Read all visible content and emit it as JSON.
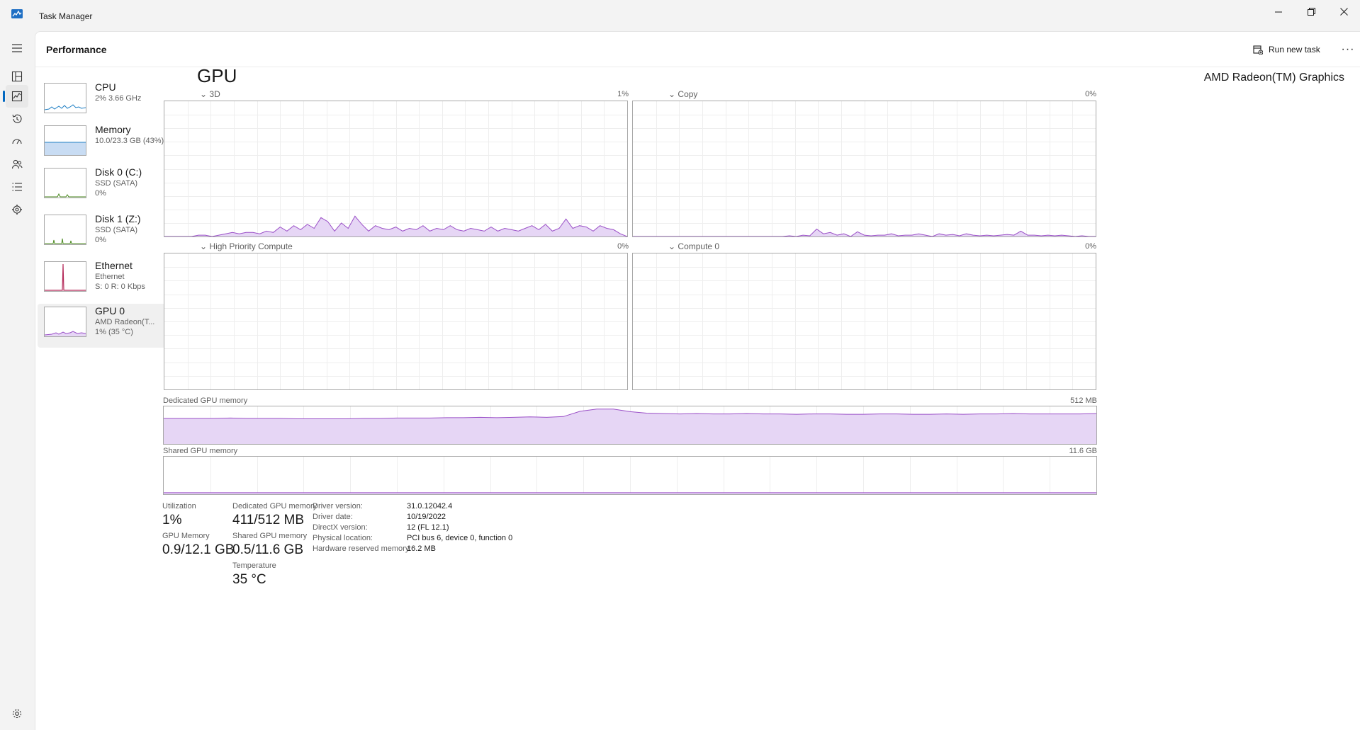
{
  "window": {
    "title": "Task Manager",
    "controls": {
      "minimize": "—",
      "maximize": "❐",
      "close": "✕"
    }
  },
  "rail": {
    "items": [
      {
        "name": "hamburger-menu-icon",
        "glyph": "☰"
      },
      {
        "name": "processes-icon",
        "glyph": "▦"
      },
      {
        "name": "performance-icon",
        "glyph": "📈",
        "active": true
      },
      {
        "name": "app-history-icon",
        "glyph": "↺"
      },
      {
        "name": "startup-apps-icon",
        "glyph": "⚡"
      },
      {
        "name": "users-icon",
        "glyph": "👥"
      },
      {
        "name": "details-icon",
        "glyph": "≣"
      },
      {
        "name": "services-icon",
        "glyph": "⚙"
      }
    ],
    "settings_glyph": "⚙"
  },
  "header": {
    "title": "Performance",
    "run_new_task": "Run new task",
    "more": "···"
  },
  "devices": [
    {
      "name": "CPU",
      "line1": "2% 3.66 GHz",
      "line2": "",
      "color": "#1f7fc4"
    },
    {
      "name": "Memory",
      "line1": "10.0/23.3 GB (43%)",
      "line2": "",
      "color": "#7d6bd3"
    },
    {
      "name": "Disk 0 (C:)",
      "line1": "SSD (SATA)",
      "line2": "0%",
      "color": "#4b8a1f"
    },
    {
      "name": "Disk 1 (Z:)",
      "line1": "SSD (SATA)",
      "line2": "0%",
      "color": "#4b8a1f"
    },
    {
      "name": "Ethernet",
      "line1": "Ethernet",
      "line2": "S: 0 R: 0 Kbps",
      "color": "#b52c5b"
    },
    {
      "name": "GPU 0",
      "line1": "AMD Radeon(T...",
      "line2": "1% (35 °C)",
      "color": "#9a4fc7",
      "selected": true
    }
  ],
  "gpu": {
    "title": "GPU",
    "model": "AMD Radeon(TM) Graphics",
    "accent": "#9a4fc7",
    "fill": "#e6d6f5",
    "engines": [
      {
        "label": "3D",
        "value": "1%"
      },
      {
        "label": "Copy",
        "value": "0%"
      },
      {
        "label": "High Priority Compute",
        "value": "0%"
      },
      {
        "label": "Compute 0",
        "value": "0%"
      }
    ],
    "dedicated": {
      "label": "Dedicated GPU memory",
      "max": "512 MB"
    },
    "shared": {
      "label": "Shared GPU memory",
      "max": "11.6 GB"
    }
  },
  "stats": {
    "utilization": {
      "label": "Utilization",
      "value": "1%"
    },
    "gpu_memory": {
      "label": "GPU Memory",
      "value": "0.9/12.1 GB"
    },
    "dedicated_memory": {
      "label": "Dedicated GPU memory",
      "value": "411/512 MB"
    },
    "shared_memory": {
      "label": "Shared GPU memory",
      "value": "0.5/11.6 GB"
    },
    "temperature": {
      "label": "Temperature",
      "value": "35 °C"
    }
  },
  "details": [
    {
      "key": "Driver version:",
      "value": "31.0.12042.4"
    },
    {
      "key": "Driver date:",
      "value": "10/19/2022"
    },
    {
      "key": "DirectX version:",
      "value": "12 (FL 12.1)"
    },
    {
      "key": "Physical location:",
      "value": "PCI bus 6, device 0, function 0"
    },
    {
      "key": "Hardware reserved memory:",
      "value": "16.2 MB"
    }
  ]
}
